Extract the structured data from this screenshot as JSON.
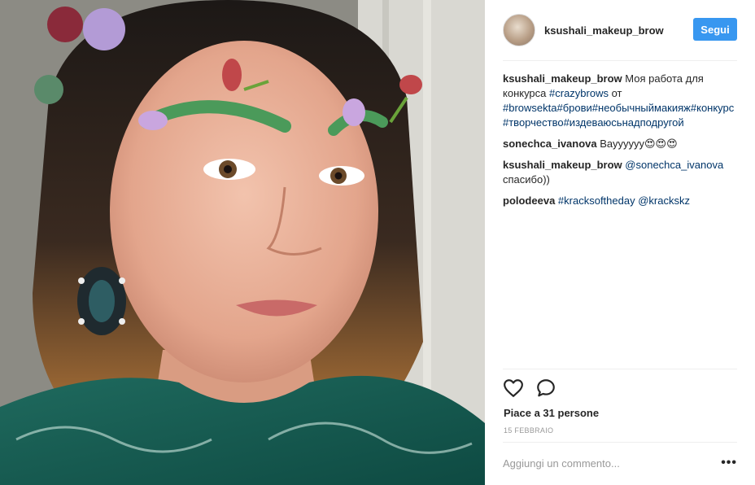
{
  "post": {
    "image_alt": "Portrait of a woman with floral eyebrow makeup",
    "header": {
      "username": "ksushali_makeup_brow",
      "follow_label": "Segui"
    },
    "comments": [
      {
        "author": "ksushali_makeup_brow",
        "parts": [
          {
            "text": " Моя работа для конкурса ",
            "type": "text"
          },
          {
            "text": "#crazybrows",
            "type": "link"
          },
          {
            "text": " от ",
            "type": "text"
          },
          {
            "text": "#browsekta",
            "type": "link"
          },
          {
            "text": "#брови",
            "type": "link"
          },
          {
            "text": "#необычныймакияж",
            "type": "link"
          },
          {
            "text": "#конкурс",
            "type": "link"
          },
          {
            "text": "#творчество",
            "type": "link"
          },
          {
            "text": "#издеваюсьнадподругой",
            "type": "link"
          }
        ]
      },
      {
        "author": "sonechca_ivanova",
        "parts": [
          {
            "text": " Вауууууу😍😍😍",
            "type": "text"
          }
        ]
      },
      {
        "author": "ksushali_makeup_brow",
        "parts": [
          {
            "text": " ",
            "type": "text"
          },
          {
            "text": "@sonechca_ivanova",
            "type": "link"
          },
          {
            "text": " спасибо))",
            "type": "text"
          }
        ]
      },
      {
        "author": "polodeeva",
        "parts": [
          {
            "text": " ",
            "type": "text"
          },
          {
            "text": "#kracksoftheday",
            "type": "link"
          },
          {
            "text": " ",
            "type": "text"
          },
          {
            "text": "@krackskz",
            "type": "link"
          }
        ]
      }
    ],
    "actions": {
      "like_icon": "heart-icon",
      "comment_icon": "comment-bubble-icon",
      "likes_text": "Piace a 31 persone",
      "date": "15 febbraio"
    },
    "add_comment": {
      "placeholder": "Aggiungi un commento...",
      "more_label": "•••"
    }
  }
}
